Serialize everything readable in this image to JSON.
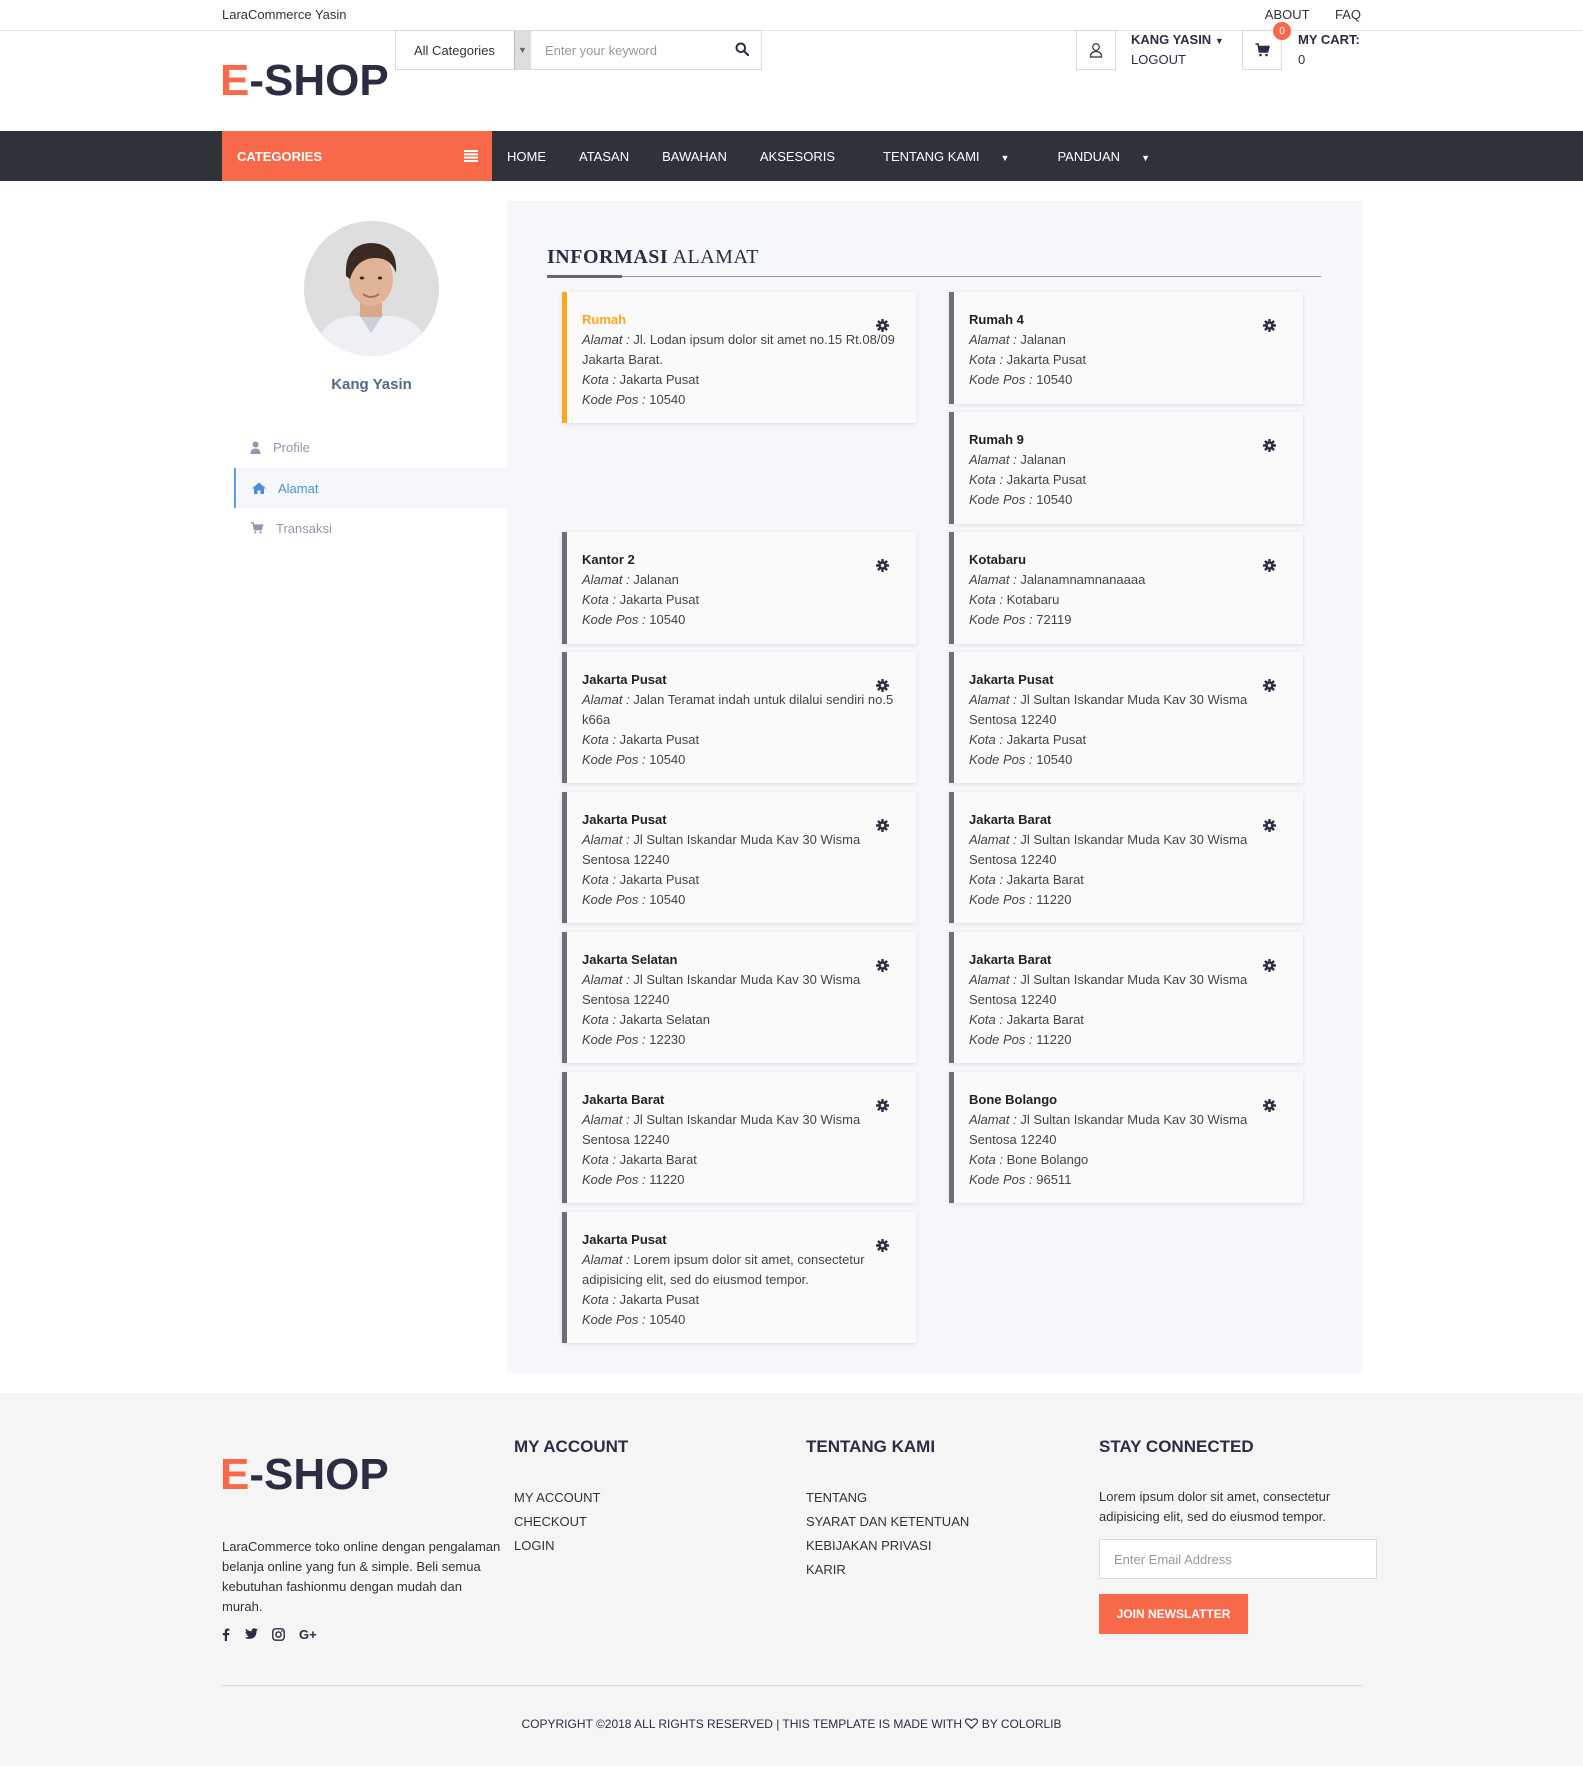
{
  "topbar": {
    "brand": "LaraCommerce Yasin",
    "about": "ABOUT",
    "faq": "FAQ"
  },
  "header": {
    "logo_e": "E",
    "logo_rest": "-SHOP",
    "search_category": "All Categories",
    "search_placeholder": "Enter your keyword",
    "account_name": "KANG YASIN",
    "account_logout": "LOGOUT",
    "cart_badge": "0",
    "cart_label": "MY CART:",
    "cart_count": "0"
  },
  "nav": {
    "categories": "CATEGORIES",
    "items": [
      "HOME",
      "ATASAN",
      "BAWAHAN",
      "AKSESORIS",
      "TENTANG KAMI",
      "PANDUAN"
    ]
  },
  "sidebar": {
    "name": "Kang Yasin",
    "items": [
      {
        "label": "Profile",
        "icon": "user-icon"
      },
      {
        "label": "Alamat",
        "icon": "home-icon"
      },
      {
        "label": "Transaksi",
        "icon": "cart-icon"
      }
    ]
  },
  "main": {
    "title_bold": "INFORMASI",
    "title_rest": "ALAMAT",
    "labels": {
      "alamat": "Alamat :",
      "kota": "Kota :",
      "kodepos": "Kode Pos :"
    },
    "addresses": [
      {
        "name": "Rumah",
        "alamat": "Jl. Lodan ipsum dolor sit amet no.15 Rt.08/09 Jakarta Barat.",
        "kota": "Jakarta Pusat",
        "kodepos": "10540"
      },
      {
        "name": "Rumah 4",
        "alamat": "Jalanan",
        "kota": "Jakarta Pusat",
        "kodepos": "10540"
      },
      {
        "name": "Rumah 9",
        "alamat": "Jalanan",
        "kota": "Jakarta Pusat",
        "kodepos": "10540"
      },
      {
        "name": "Kantor 2",
        "alamat": "Jalanan",
        "kota": "Jakarta Pusat",
        "kodepos": "10540"
      },
      {
        "name": "Kotabaru",
        "alamat": "Jalanamnamnanaaaa",
        "kota": "Kotabaru",
        "kodepos": "72119"
      },
      {
        "name": "Jakarta Pusat",
        "alamat": "Jalan Teramat indah untuk dilalui sendiri no.5 k66a",
        "kota": "Jakarta Pusat",
        "kodepos": "10540"
      },
      {
        "name": "Jakarta Pusat",
        "alamat": "Jl Sultan Iskandar Muda Kav 30 Wisma Sentosa 12240",
        "kota": "Jakarta Pusat",
        "kodepos": "10540"
      },
      {
        "name": "Jakarta Pusat",
        "alamat": "Jl Sultan Iskandar Muda Kav 30 Wisma Sentosa 12240",
        "kota": "Jakarta Pusat",
        "kodepos": "10540"
      },
      {
        "name": "Jakarta Barat",
        "alamat": "Jl Sultan Iskandar Muda Kav 30 Wisma Sentosa 12240",
        "kota": "Jakarta Barat",
        "kodepos": "11220"
      },
      {
        "name": "Jakarta Selatan",
        "alamat": "Jl Sultan Iskandar Muda Kav 30 Wisma Sentosa 12240",
        "kota": "Jakarta Selatan",
        "kodepos": "12230"
      },
      {
        "name": "Jakarta Barat",
        "alamat": "Jl Sultan Iskandar Muda Kav 30 Wisma Sentosa 12240",
        "kota": "Jakarta Barat",
        "kodepos": "11220"
      },
      {
        "name": "Jakarta Barat",
        "alamat": "Jl Sultan Iskandar Muda Kav 30 Wisma Sentosa 12240",
        "kota": "Jakarta Barat",
        "kodepos": "11220"
      },
      {
        "name": "Bone Bolango",
        "alamat": "Jl Sultan Iskandar Muda Kav 30 Wisma Sentosa 12240",
        "kota": "Bone Bolango",
        "kodepos": "96511"
      },
      {
        "name": "Jakarta Pusat",
        "alamat": "Lorem ipsum dolor sit amet, consectetur adipisicing elit, sed do eiusmod tempor.",
        "kota": "Jakarta Pusat",
        "kodepos": "10540"
      }
    ]
  },
  "footer": {
    "description": "LaraCommerce toko online dengan pengalaman belanja online yang fun & simple. Beli semua kebutuhan fashionmu dengan mudah dan murah.",
    "my_account_title": "MY ACCOUNT",
    "my_account_links": [
      "MY ACCOUNT",
      "CHECKOUT",
      "LOGIN"
    ],
    "tentang_title": "TENTANG KAMI",
    "tentang_links": [
      "TENTANG",
      "SYARAT DAN KETENTUAN",
      "KEBIJAKAN PRIVASI",
      "KARIR"
    ],
    "stay_title": "STAY CONNECTED",
    "stay_text": "Lorem ipsum dolor sit amet, consectetur adipisicing elit, sed do eiusmod tempor.",
    "email_placeholder": "Enter Email Address",
    "join_label": "JOIN NEWSLATTER",
    "copyright_pre": "COPYRIGHT ©2018 ALL RIGHTS RESERVED | THIS TEMPLATE IS MADE WITH",
    "copyright_post": "BY COLORLIB"
  },
  "colors": {
    "accent": "#f8694a",
    "nav_bg": "#30323a",
    "primary_address": "#f9a620",
    "dark": "#2b2d42"
  }
}
